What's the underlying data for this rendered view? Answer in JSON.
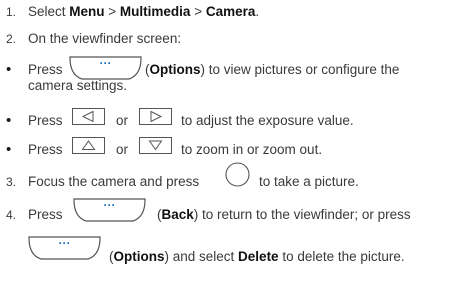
{
  "steps": {
    "s1": {
      "num": "1.",
      "pre": "Select ",
      "menu": "Menu",
      "sep1": " > ",
      "multimedia": "Multimedia",
      "sep2": " > ",
      "camera": "Camera",
      "end": "."
    },
    "s2": {
      "num": "2.",
      "text": "On the viewfinder screen:"
    },
    "b1": {
      "press": "Press",
      "options": "Options",
      "rest_line1": ") to view pictures or configure the",
      "line2": "camera settings."
    },
    "b2": {
      "press": "Press",
      "or": "or",
      "rest": "to adjust the exposure value."
    },
    "b3": {
      "press": "Press",
      "or": "or",
      "rest": "to zoom in or zoom out."
    },
    "s3": {
      "num": "3.",
      "pre": "Focus the camera and press",
      "rest": "to take a picture."
    },
    "s4": {
      "num": "4.",
      "press": "Press",
      "back": "Back",
      "rest_line1": ") to return to the viewfinder; or press",
      "options": "Options",
      "and_select": ") and select ",
      "delete": "Delete",
      "rest_line2": " to delete the picture."
    }
  },
  "icons": {
    "softkey_dots": "···"
  },
  "colors": {
    "text": "#3a3a3a",
    "bold": "#111111",
    "key_stroke": "#555555"
  }
}
